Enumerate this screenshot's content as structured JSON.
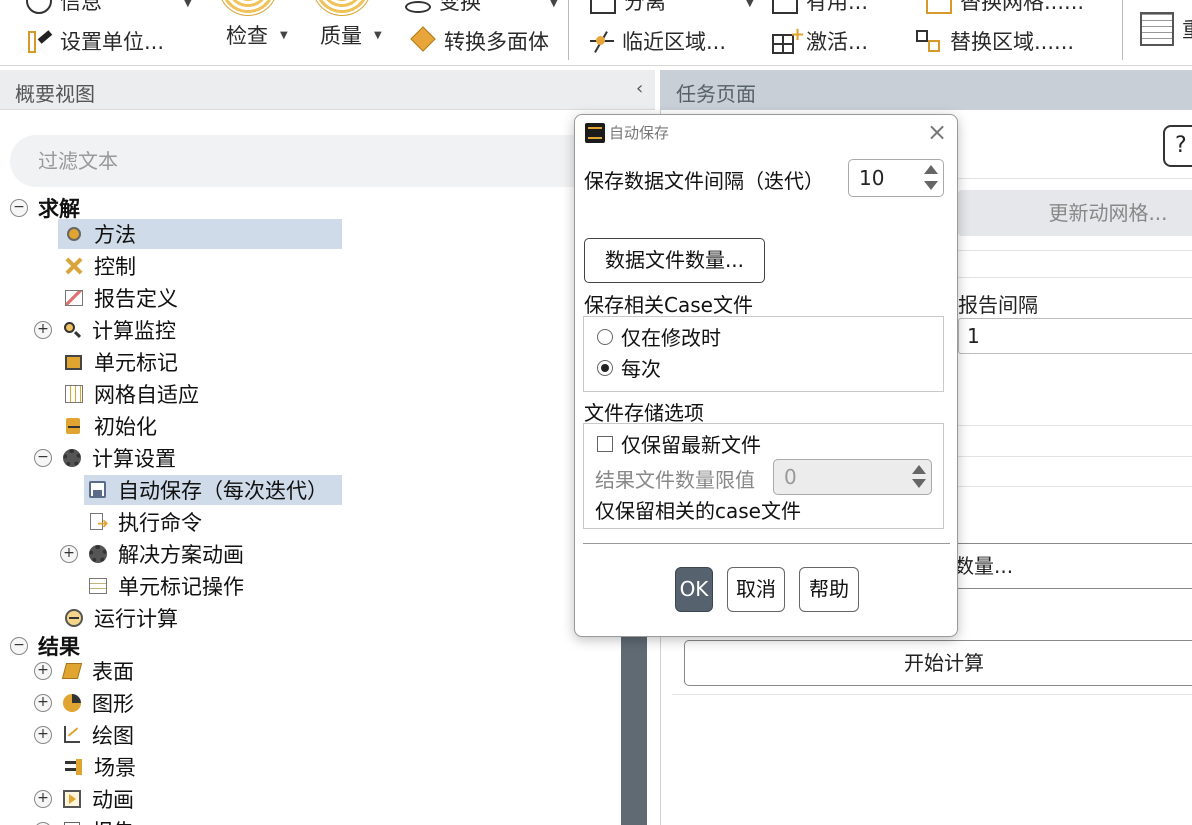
{
  "ribbon": {
    "partial_top_left": "信息",
    "partial_top_mid": "变换",
    "partial_top_right1": "分离",
    "partial_top_right2": "有用...",
    "partial_top_right3": "替换网格......",
    "set_units": "设置单位...",
    "check": "检查",
    "quality": "质量",
    "convert_poly": "转换多面体",
    "adjacent_zone": "临近区域...",
    "activate": "激活...",
    "replace_zone": "替换区域......",
    "partial_far_right": "重"
  },
  "left_panel": {
    "title": "概要视图",
    "collapse": "‹",
    "filter_placeholder": "过滤文本"
  },
  "tree": {
    "solve": "求解",
    "methods": "方法",
    "controls": "控制",
    "report_defs": "报告定义",
    "monitors": "计算监控",
    "cell_registers": "单元标记",
    "mesh_adapt": "网格自适应",
    "initialization": "初始化",
    "calc_activities": "计算设置",
    "autosave": "自动保存（每次迭代）",
    "execute_commands": "执行命令",
    "solution_animations": "解决方案动画",
    "cell_register_ops": "单元标记操作",
    "run_calc": "运行计算",
    "results": "结果",
    "surfaces": "表面",
    "graphics": "图形",
    "plots": "绘图",
    "scene": "场景",
    "animations": "动画",
    "reports_partial": "报告"
  },
  "right_panel": {
    "title": "任务页面",
    "help": "?",
    "update_dynamic_mesh": "更新动网格...",
    "report_interval_label": "报告间隔",
    "report_interval_value": "1",
    "count_partial": "数量...",
    "start_calc": "开始计算"
  },
  "dialog": {
    "title": "自动保存",
    "close": "×",
    "save_interval_label": "保存数据文件间隔（迭代）",
    "save_interval_value": "10",
    "data_files_button": "数据文件数量...",
    "save_case_label": "保存相关Case文件",
    "opt_modified": "仅在修改时",
    "opt_each": "每次",
    "storage_label": "文件存储选项",
    "retain_latest": "仅保留最新文件",
    "max_files_label": "结果文件数量限值",
    "max_files_value": "0",
    "retain_case": "仅保留相关的case文件",
    "ok": "OK",
    "cancel": "取消",
    "help": "帮助"
  },
  "colors": {
    "selection": "#cfdbe8",
    "ok_button": "#56636f",
    "right_header": "#c9cfd6",
    "scrollbar": "#5f6a73"
  }
}
